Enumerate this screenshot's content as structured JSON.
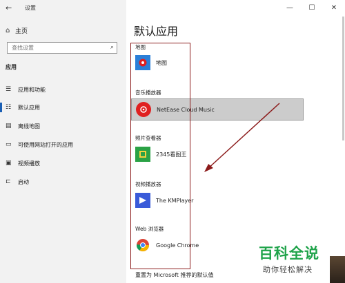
{
  "window": {
    "title": "设置",
    "controls": {
      "minimize": "—",
      "maximize": "☐",
      "close": "✕"
    }
  },
  "sidebar": {
    "home": "主页",
    "search_placeholder": "查找设置",
    "section": "应用",
    "items": [
      {
        "label": "应用和功能",
        "icon": "apps-list-icon"
      },
      {
        "label": "默认应用",
        "icon": "default-apps-icon"
      },
      {
        "label": "离线地图",
        "icon": "offline-map-icon"
      },
      {
        "label": "可使用网站打开的应用",
        "icon": "website-apps-icon"
      },
      {
        "label": "视频播放",
        "icon": "video-icon"
      },
      {
        "label": "启动",
        "icon": "startup-icon"
      }
    ]
  },
  "main": {
    "title": "默认应用",
    "categories": [
      {
        "label": "地图",
        "app": "地图",
        "icon_color": "#2b7fd8"
      },
      {
        "label": "音乐播放器",
        "app": "NetEase Cloud Music",
        "icon_color": "#e02020"
      },
      {
        "label": "照片查看器",
        "app": "2345看图王",
        "icon_color": "#2aa245"
      },
      {
        "label": "视频播放器",
        "app": "The KMPlayer",
        "icon_color": "#3a5bd9"
      },
      {
        "label": "Web 浏览器",
        "app": "Google Chrome",
        "icon_color": "#ffffff"
      }
    ],
    "reset_label": "重置为 Microsoft 推荐的默认值"
  },
  "watermark": {
    "main": "百科全说",
    "sub": "助你轻松解决"
  },
  "colors": {
    "annotation": "#8b1a1a",
    "accent": "#1a5fb4",
    "highlight": "#cccccc"
  }
}
